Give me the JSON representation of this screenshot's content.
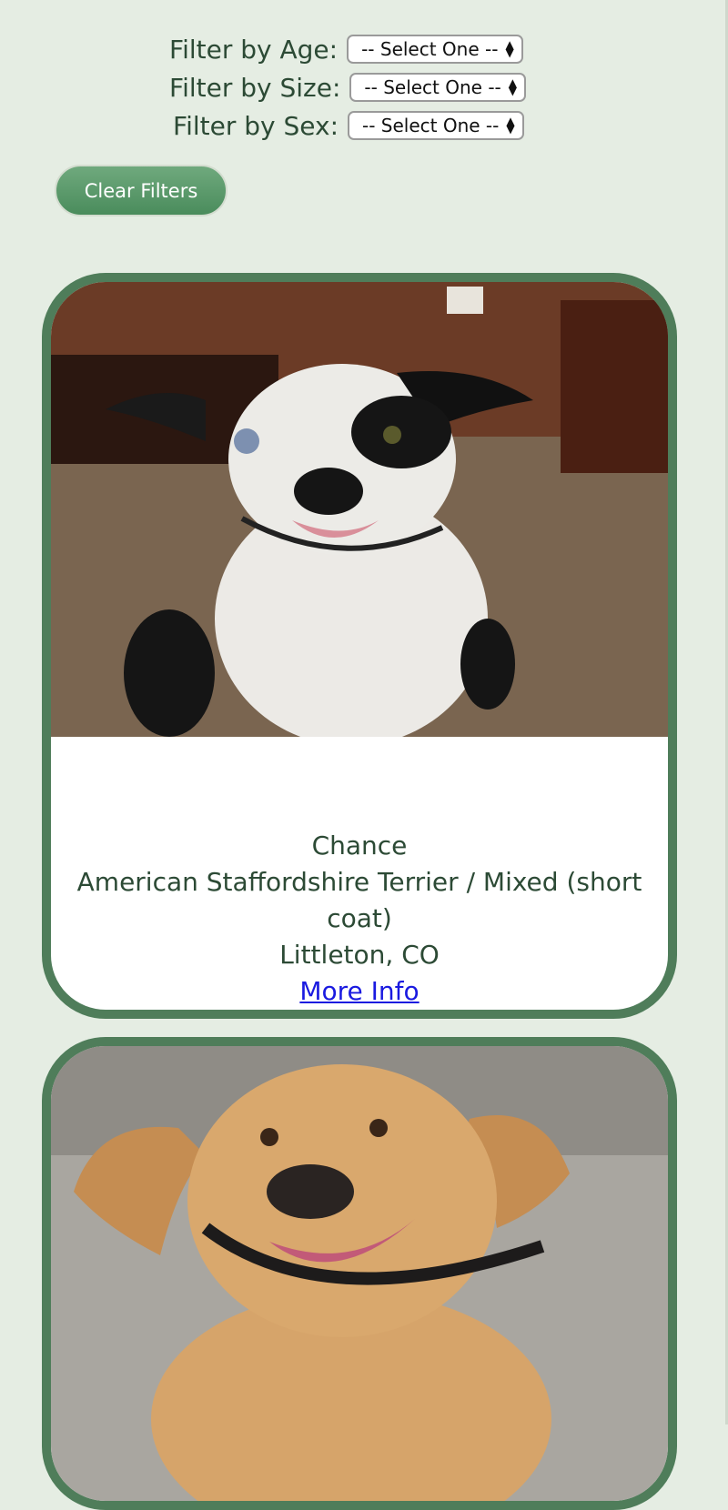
{
  "filters": [
    {
      "label": "Filter by Age:",
      "selected": "-- Select One --"
    },
    {
      "label": "Filter by Size:",
      "selected": "-- Select One --"
    },
    {
      "label": "Filter by Sex:",
      "selected": "-- Select One --"
    }
  ],
  "clear_button": "Clear Filters",
  "pets": [
    {
      "name": "Chance",
      "breed": "American Staffordshire Terrier / Mixed (short coat)",
      "location": "Littleton, CO",
      "link": "More Info"
    },
    {
      "name": "",
      "breed": "",
      "location": "",
      "link": ""
    }
  ],
  "colors": {
    "background": "#e5ede3",
    "card_border": "#4f7d5a",
    "button": "#5b9a6b",
    "link": "#1a1ae0"
  }
}
